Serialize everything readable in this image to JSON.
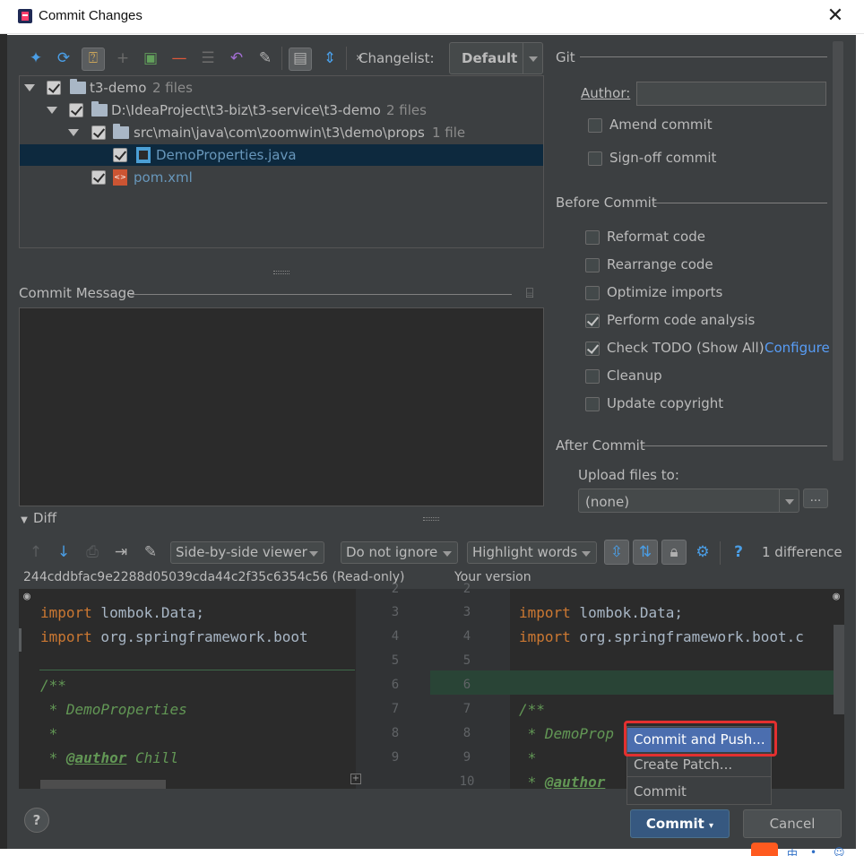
{
  "window": {
    "title": "Commit Changes"
  },
  "toolbar": {
    "changelist_label": "Changelist:",
    "changelist_value": "Default"
  },
  "tree": [
    {
      "label": "t3-demo",
      "count": "2 files"
    },
    {
      "label": "D:\\IdeaProject\\t3-biz\\t3-service\\t3-demo",
      "count": "2 files"
    },
    {
      "label": "src\\main\\java\\com\\zoomwin\\t3\\demo\\props",
      "count": "1 file"
    },
    {
      "label": "DemoProperties.java",
      "count": ""
    },
    {
      "label": "pom.xml",
      "count": ""
    }
  ],
  "commit_message": {
    "label": "Commit Message",
    "value": ""
  },
  "git": {
    "section": "Git",
    "author_label": "Author:",
    "author_value": "",
    "amend": "Amend commit",
    "signoff": "Sign-off commit"
  },
  "before_commit": {
    "section": "Before Commit",
    "options": [
      {
        "label": "Reformat code",
        "checked": false
      },
      {
        "label": "Rearrange code",
        "checked": false
      },
      {
        "label": "Optimize imports",
        "checked": false
      },
      {
        "label": "Perform code analysis",
        "checked": true
      },
      {
        "label": "Check TODO (Show All)",
        "checked": true
      },
      {
        "label": "Cleanup",
        "checked": false
      },
      {
        "label": "Update copyright",
        "checked": false
      }
    ],
    "configure_link": "Configure"
  },
  "after_commit": {
    "section": "After Commit",
    "upload_label": "Upload files to:",
    "upload_value": "(none)",
    "more_button": "..."
  },
  "diff": {
    "label": "Diff",
    "viewer": "Side-by-side viewer",
    "whitespace": "Do not ignore",
    "highlight": "Highlight words",
    "status": "1 difference",
    "left_header": "244cddbfac9e2288d05039cda44c2f35c6354c56 (Read-only)",
    "right_header": "Your version",
    "left_numbers": [
      "2",
      "3",
      "4",
      "5",
      "6",
      "7",
      "8",
      "9"
    ],
    "right_numbers": [
      "2",
      "3",
      "4",
      "5",
      "6",
      "7",
      "8",
      "9",
      "10"
    ],
    "left_lines": [
      {
        "kw": "import",
        "rest": " lombok.Data;"
      },
      {
        "kw": "import",
        "rest": " org.springframework.boot"
      },
      {
        "kw": "",
        "rest": ""
      },
      {
        "cm": "/**"
      },
      {
        "cm": " * DemoProperties"
      },
      {
        "cm": " *"
      },
      {
        "cm": " * ",
        "tag": "@author",
        "cm2": " Chill"
      }
    ],
    "right_lines": [
      {
        "kw": "import",
        "rest": " lombok.Data;"
      },
      {
        "kw": "import",
        "rest": " org.springframework.boot.c"
      },
      {
        "kw": "",
        "rest": ""
      },
      {
        "kw": "",
        "rest": ""
      },
      {
        "cm": "/**"
      },
      {
        "cm": " * DemoProp"
      },
      {
        "cm": " *"
      },
      {
        "cm": " * ",
        "tag": "@author",
        "cm2": ""
      }
    ]
  },
  "popup": {
    "items": [
      "Commit and Push...",
      "Create Patch...",
      "Commit"
    ]
  },
  "buttons": {
    "commit": "Commit",
    "cancel": "Cancel",
    "help": "?"
  },
  "colors": {
    "background": "#3c3f41",
    "editor": "#2b2b2b",
    "selection": "#0d293e",
    "highlight": "#4b6eaf",
    "annotation": "#e33030"
  }
}
